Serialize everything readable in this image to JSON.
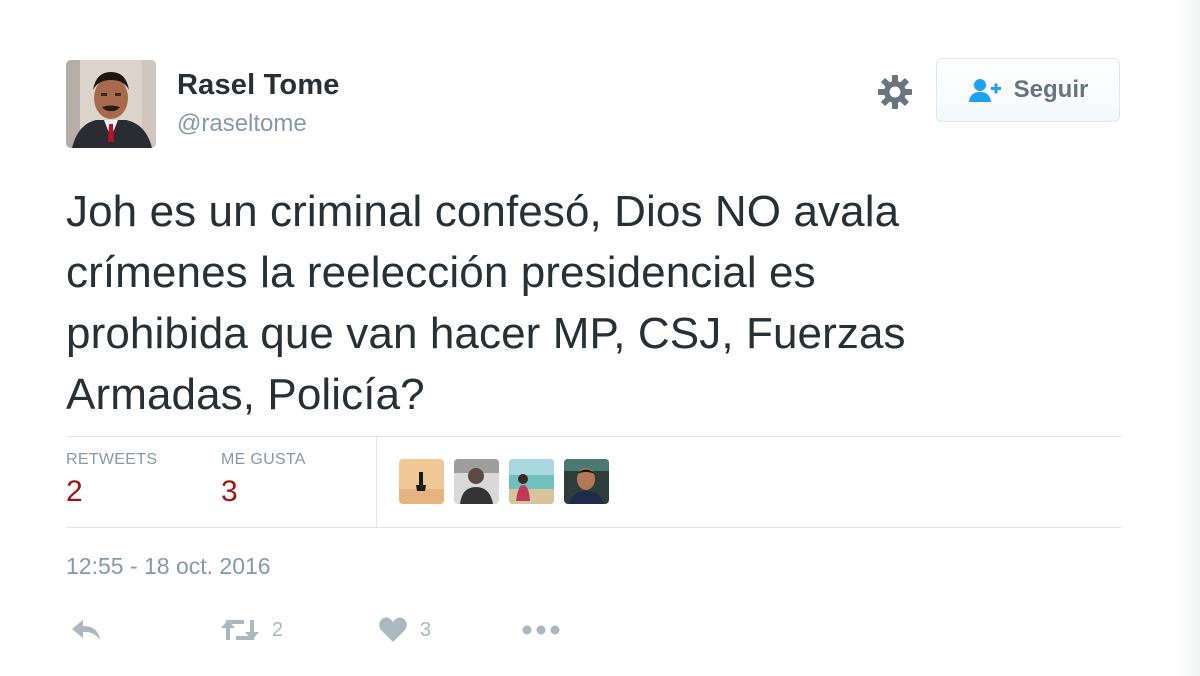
{
  "user": {
    "display_name": "Rasel Tome",
    "screen_name": "@raseltome",
    "avatar_icon": "profile-photo"
  },
  "header": {
    "settings_icon": "gear-icon",
    "follow_button": {
      "label": "Seguir",
      "icon": "add-user-icon"
    }
  },
  "tweet": {
    "text": "Joh es un criminal confesó, Dios NO avala\ncrímenes la reelección presidencial es\nprohibida que van hacer MP, CSJ, Fuerzas\nArmadas, Policía?"
  },
  "stats": {
    "retweets": {
      "label": "RETWEETS",
      "value": "2"
    },
    "likes": {
      "label": "ME GUSTA",
      "value": "3"
    },
    "liker_avatars": [
      "liker-avatar-1",
      "liker-avatar-2",
      "liker-avatar-3",
      "liker-avatar-4"
    ]
  },
  "timestamp": "12:55 - 18 oct. 2016",
  "actions": {
    "reply_icon": "reply-icon",
    "retweet_count": "2",
    "like_count": "3",
    "more_icon": "more-icon"
  },
  "colors": {
    "text": "#292f33",
    "muted": "#8899a6",
    "count_red": "#a0160e",
    "border": "#e1e8ed",
    "icon_grey": "#aab8c2"
  }
}
